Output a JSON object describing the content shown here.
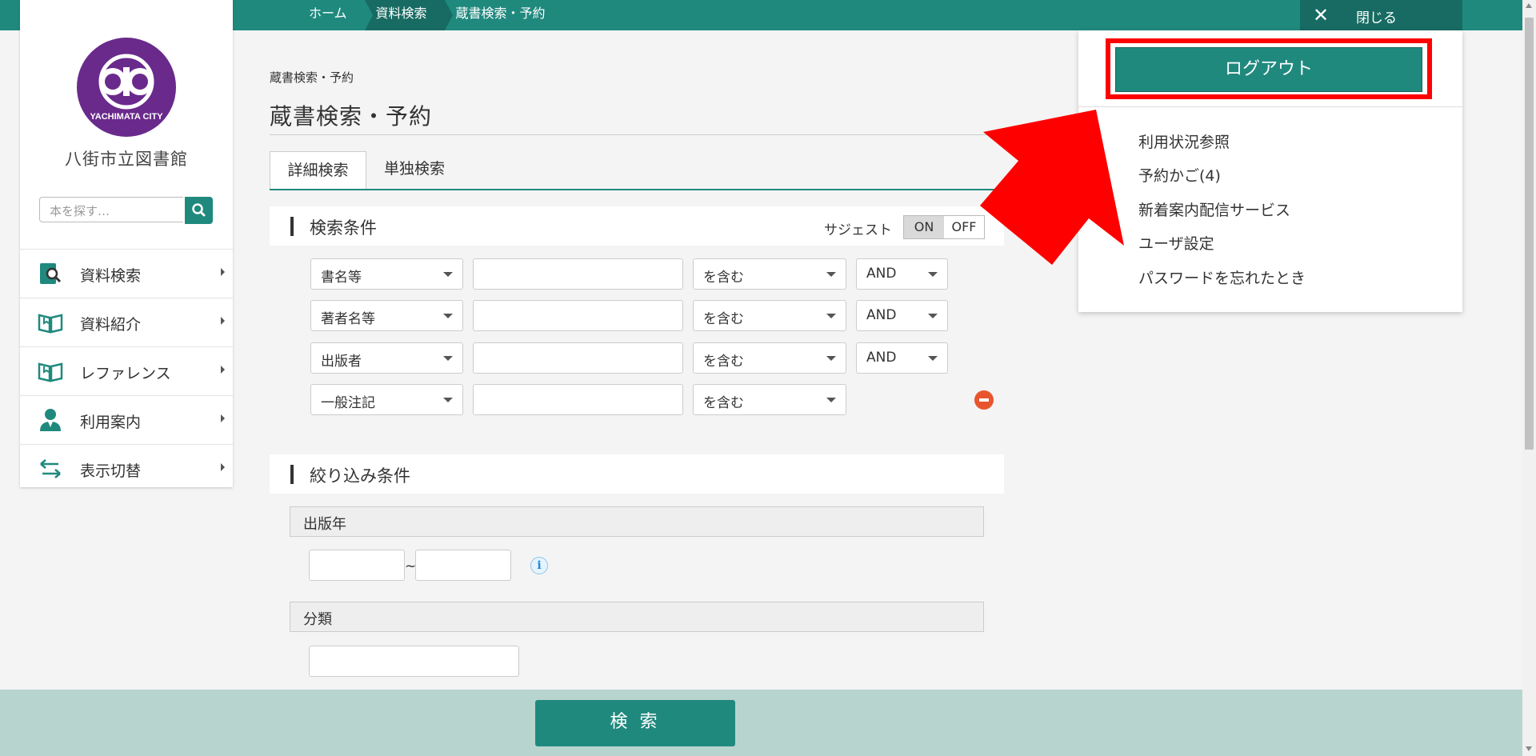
{
  "topbar": {
    "breadcrumbs": [
      "ホーム",
      "資料検索",
      "蔵書検索・予約"
    ],
    "close_label": "閉じる"
  },
  "sidebar": {
    "logo_text": "YACHIMATA CITY",
    "library_name": "八街市立図書館",
    "search_placeholder": "本を探す…",
    "items": [
      {
        "label": "資料検索",
        "icon": "book-search-icon"
      },
      {
        "label": "資料紹介",
        "icon": "open-book-icon"
      },
      {
        "label": "レファレンス",
        "icon": "open-book-icon"
      },
      {
        "label": "利用案内",
        "icon": "user-icon"
      },
      {
        "label": "表示切替",
        "icon": "swap-arrows-icon"
      }
    ]
  },
  "main": {
    "breadcrumb": "蔵書検索・予約",
    "title": "蔵書検索・予約",
    "tabs": [
      "詳細検索",
      "単独検索"
    ],
    "search_conditions": {
      "heading": "検索条件",
      "suggest_label": "サジェスト",
      "toggle_on": "ON",
      "toggle_off": "OFF",
      "rows": [
        {
          "field": "書名等",
          "value": "",
          "match": "を含む",
          "op": "AND"
        },
        {
          "field": "著者名等",
          "value": "",
          "match": "を含む",
          "op": "AND"
        },
        {
          "field": "出版者",
          "value": "",
          "match": "を含む",
          "op": "AND"
        },
        {
          "field": "一般注記",
          "value": "",
          "match": "を含む",
          "op": ""
        }
      ]
    },
    "filter_conditions": {
      "heading": "絞り込み条件",
      "pub_year_label": "出版年",
      "range_separator": "~",
      "classification_label": "分類"
    },
    "search_button": "検 索"
  },
  "user_panel": {
    "logout_label": "ログアウト",
    "links": [
      "利用状況参照",
      "予約かご(4)",
      "新着案内配信サービス",
      "ユーザ設定",
      "パスワードを忘れたとき"
    ]
  },
  "colors": {
    "accent": "#20897e",
    "accent_dark": "#176b62",
    "highlight": "#ff0000",
    "logo_purple": "#6a2a8c"
  }
}
